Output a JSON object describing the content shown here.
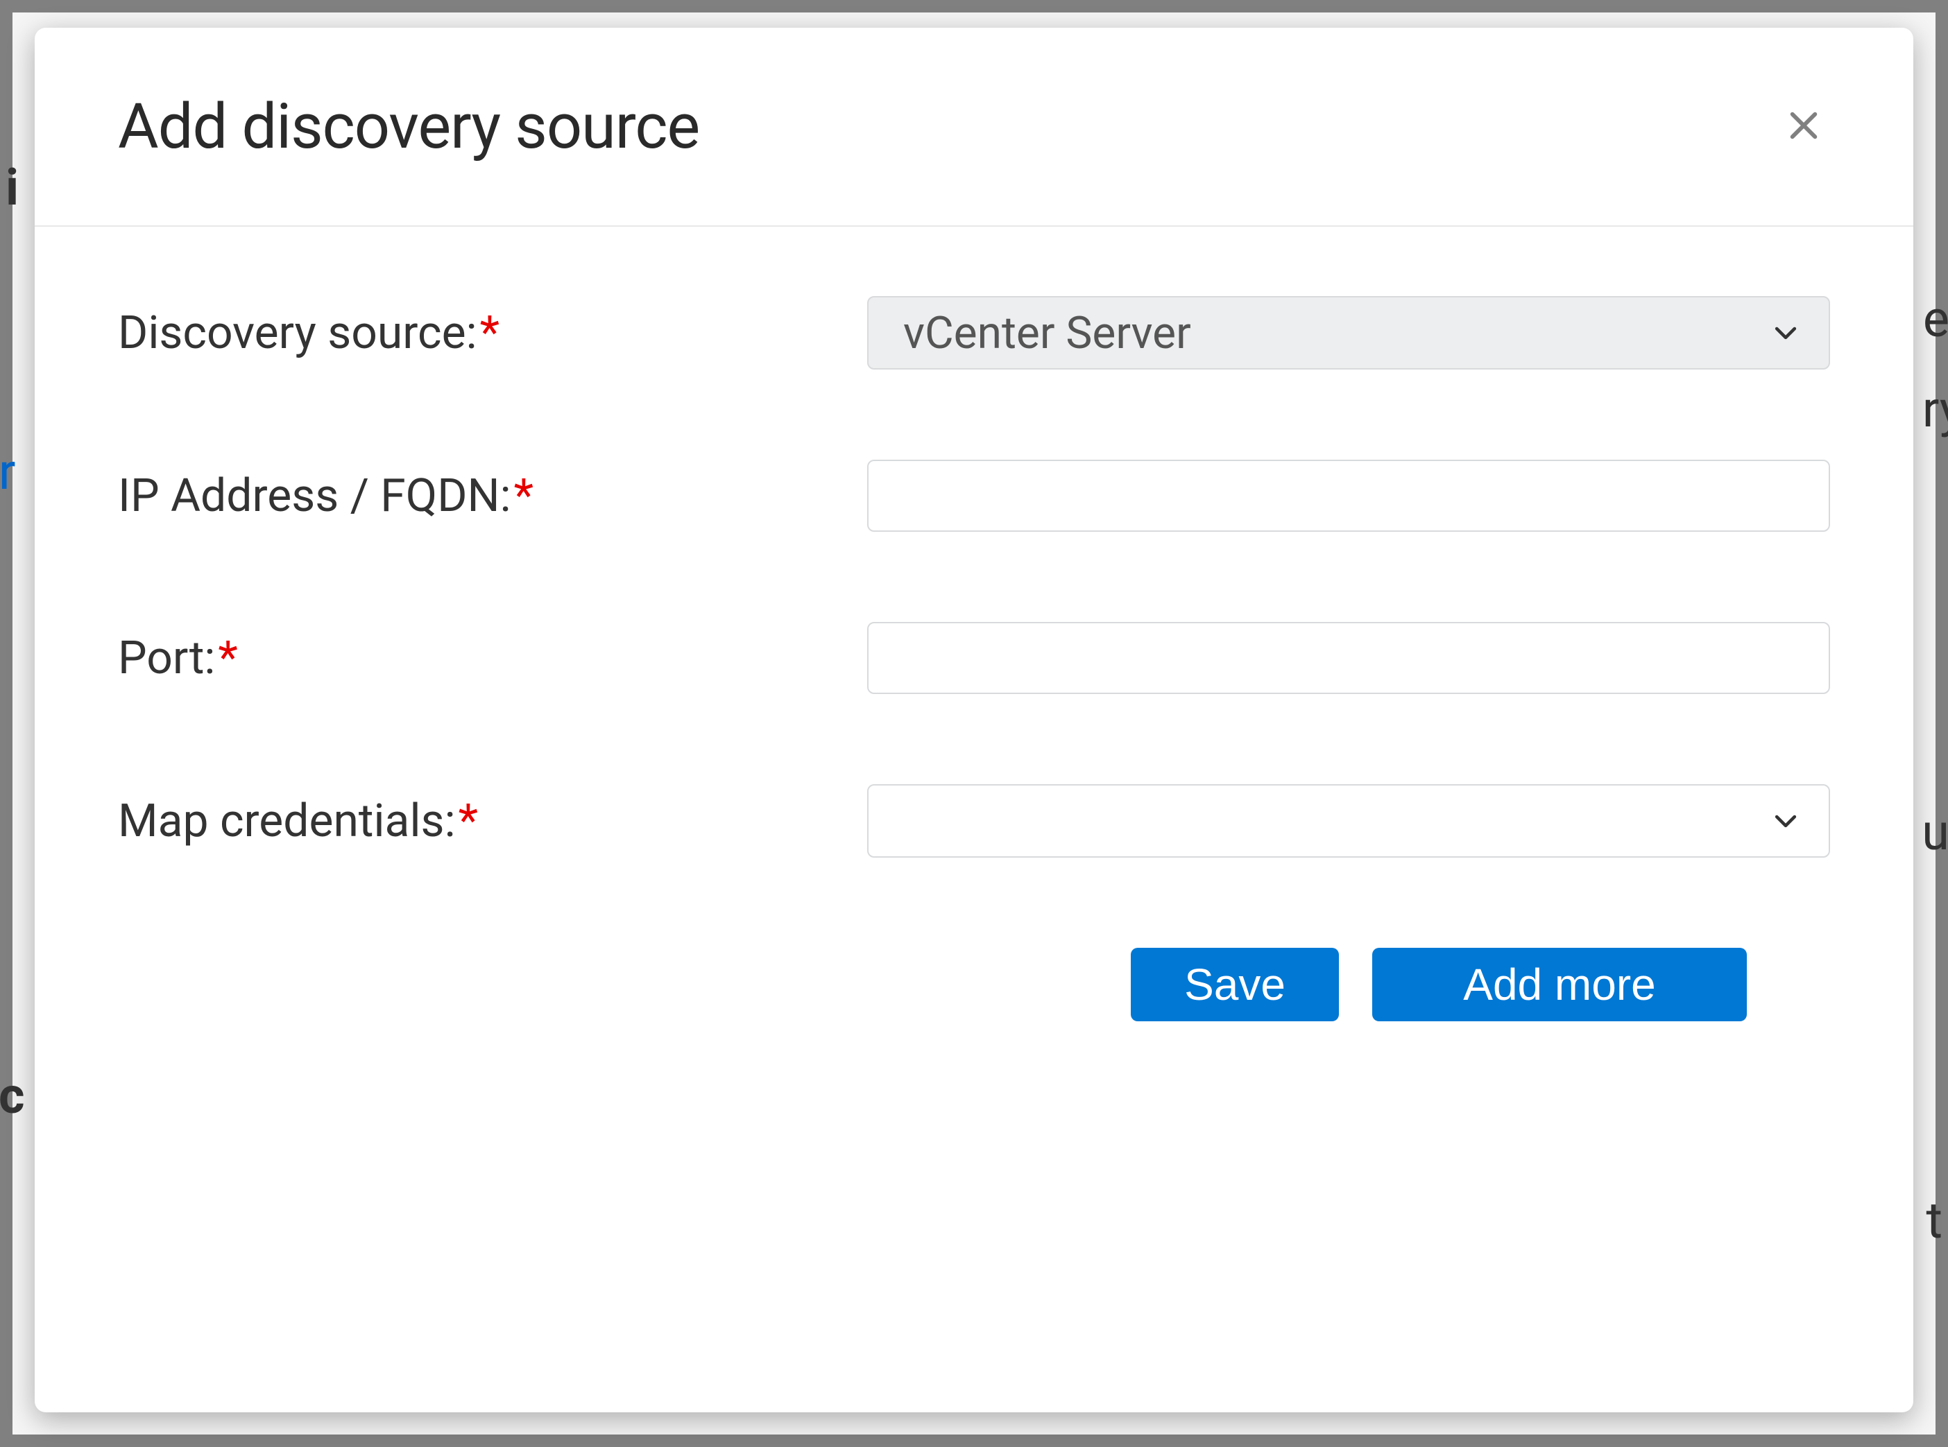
{
  "modal": {
    "title": "Add discovery source",
    "close_icon": "close-icon",
    "fields": {
      "discovery_source": {
        "label": "Discovery source:",
        "required": true,
        "value": "vCenter Server"
      },
      "ip_fqdn": {
        "label": "IP Address / FQDN:",
        "required": true,
        "value": ""
      },
      "port": {
        "label": "Port:",
        "required": true,
        "value": ""
      },
      "map_credentials": {
        "label": "Map credentials:",
        "required": true,
        "value": ""
      }
    },
    "buttons": {
      "save": "Save",
      "add_more": "Add more"
    }
  },
  "background": {
    "frag1": "i",
    "frag2": "e",
    "frag3": "ry",
    "frag4": "r",
    "frag5": "u",
    "frag6": "c",
    "frag7": "t"
  },
  "colors": {
    "primary": "#0078d4",
    "required": "#e60000",
    "border": "#d8dadc",
    "select_bg": "#eceeef"
  }
}
